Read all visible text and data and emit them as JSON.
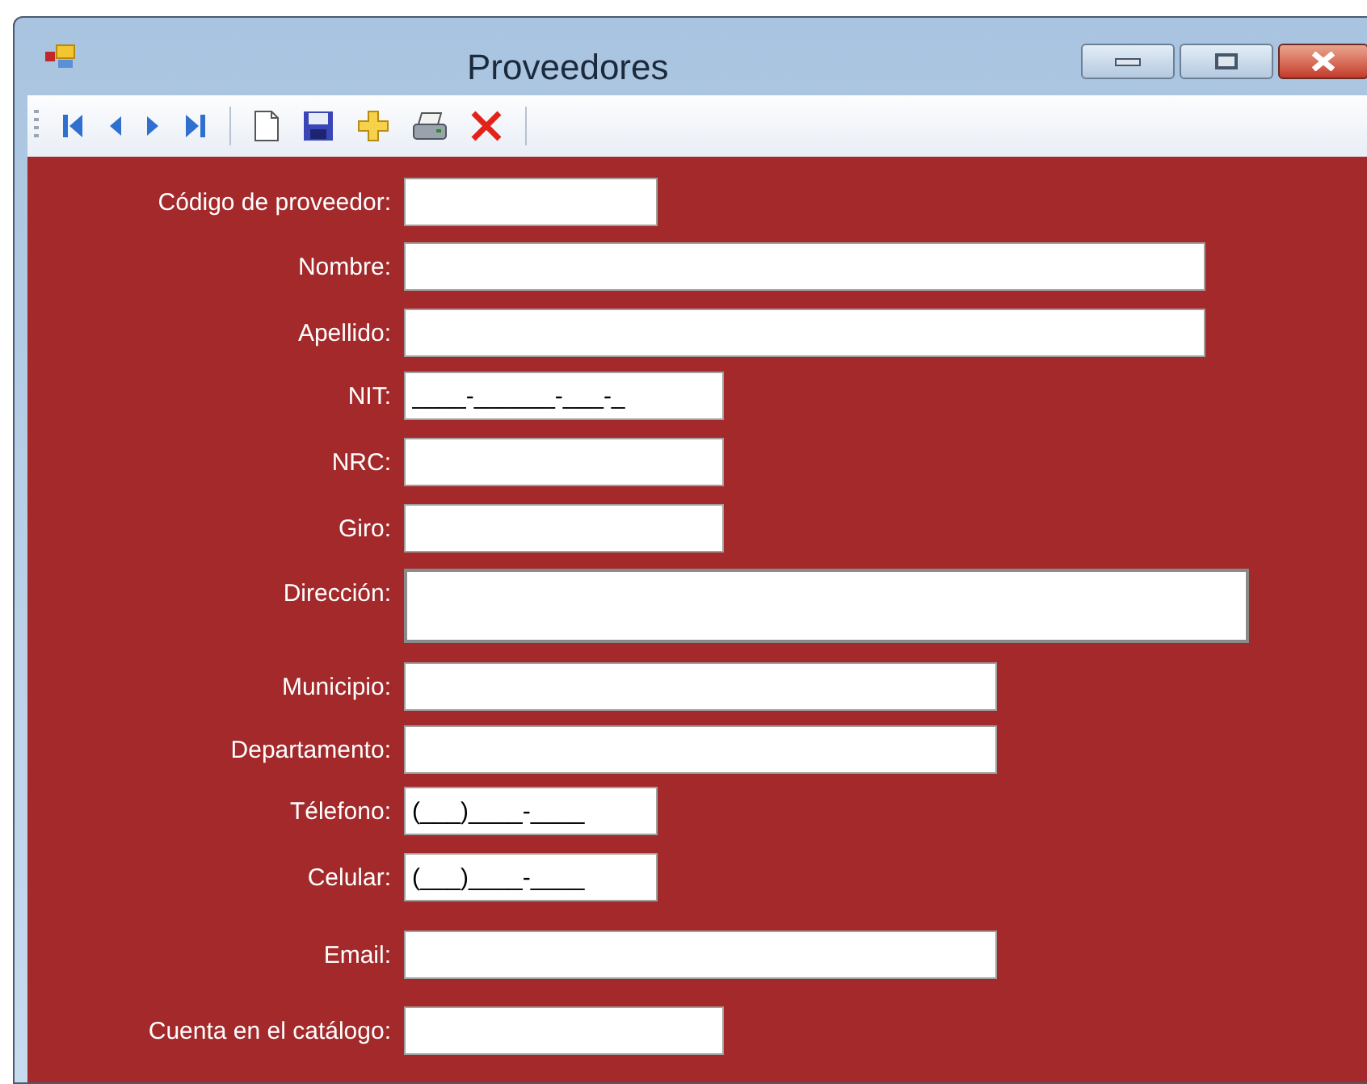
{
  "window": {
    "title": "Proveedores"
  },
  "toolbar": {
    "buttons": [
      {
        "kind": "first"
      },
      {
        "kind": "prev"
      },
      {
        "kind": "next"
      },
      {
        "kind": "last"
      },
      {
        "kind": "sep"
      },
      {
        "kind": "new"
      },
      {
        "kind": "save"
      },
      {
        "kind": "add"
      },
      {
        "kind": "print"
      },
      {
        "kind": "delete"
      },
      {
        "kind": "sep"
      }
    ]
  },
  "form": {
    "fields": [
      {
        "label": "Código de proveedor:",
        "kind": "text"
      },
      {
        "label": "Nombre:",
        "kind": "text"
      },
      {
        "label": "Apellido:",
        "kind": "text"
      },
      {
        "label": "NIT:",
        "kind": "text",
        "value": "____-______-___-_"
      },
      {
        "label": "NRC:",
        "kind": "text"
      },
      {
        "label": "Giro:",
        "kind": "text"
      },
      {
        "label": "Dirección:",
        "kind": "multiline"
      },
      {
        "label": "Municipio:",
        "kind": "text"
      },
      {
        "label": "Departamento:",
        "kind": "text"
      },
      {
        "label": "Télefono:",
        "kind": "text",
        "value": "(___)____-____"
      },
      {
        "label": "Celular:",
        "kind": "text",
        "value": "(___)____-____"
      },
      {
        "label": "Email:",
        "kind": "text"
      },
      {
        "label": "Cuenta en el catálogo:",
        "kind": "text"
      }
    ]
  }
}
